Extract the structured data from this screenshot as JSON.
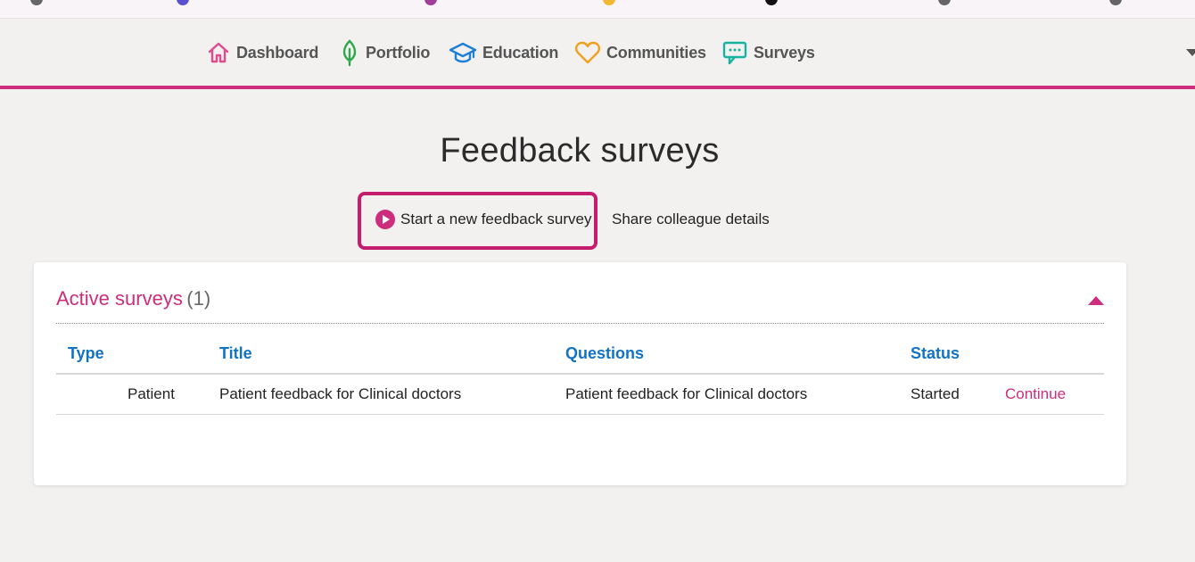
{
  "nav": {
    "items": [
      {
        "label": "Dashboard",
        "icon": "house-icon"
      },
      {
        "label": "Portfolio",
        "icon": "leaf-icon"
      },
      {
        "label": "Education",
        "icon": "graduation-cap-icon"
      },
      {
        "label": "Communities",
        "icon": "heart-icon"
      },
      {
        "label": "Surveys",
        "icon": "speech-bubble-icon"
      }
    ]
  },
  "page": {
    "title": "Feedback surveys"
  },
  "actions": {
    "start_survey": "Start a new feedback survey",
    "share_colleague": "Share colleague details"
  },
  "active_surveys": {
    "heading": "Active surveys",
    "count": "(1)",
    "columns": [
      "Type",
      "Title",
      "Questions",
      "Status"
    ],
    "rows": [
      {
        "type": "Patient",
        "title": "Patient feedback for Clinical doctors",
        "questions": "Patient feedback for Clinical doctors",
        "status": "Started",
        "action": "Continue"
      }
    ]
  },
  "colors": {
    "accent": "#cc2d7c",
    "header_link": "#1173c5"
  }
}
